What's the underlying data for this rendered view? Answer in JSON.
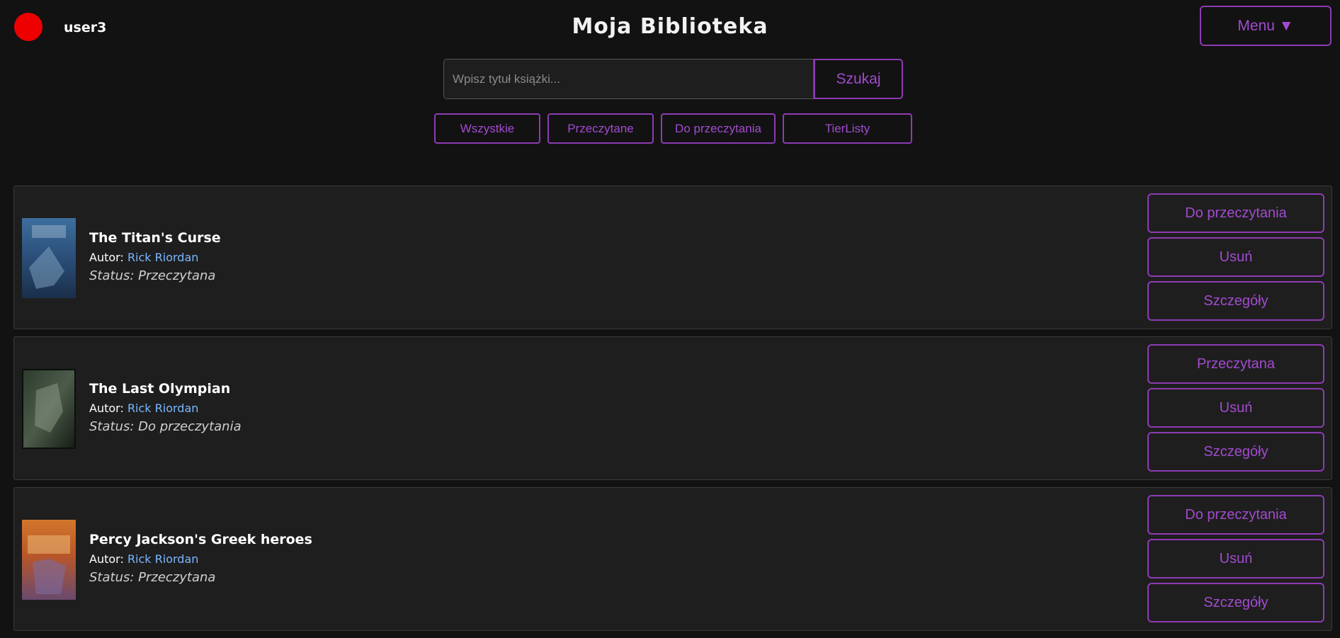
{
  "user": {
    "name": "user3"
  },
  "header": {
    "title": "Moja Biblioteka",
    "menu_label": "Menu ▼"
  },
  "search": {
    "placeholder": "Wpisz tytuł książki...",
    "value": "",
    "button_label": "Szukaj"
  },
  "filters": [
    "Wszystkie",
    "Przeczytane",
    "Do przeczytania",
    "TierListy"
  ],
  "author_prefix": "Autor:",
  "books": [
    {
      "title": "The Titan's Curse",
      "author": "Rick Riordan",
      "status": "Status: Przeczytana",
      "actions": [
        "Do przeczytania",
        "Usuń",
        "Szczegóły"
      ]
    },
    {
      "title": "The Last Olympian",
      "author": "Rick Riordan",
      "status": "Status: Do przeczytania",
      "actions": [
        "Przeczytana",
        "Usuń",
        "Szczegóły"
      ]
    },
    {
      "title": "Percy Jackson's Greek heroes",
      "author": "Rick Riordan",
      "status": "Status: Przeczytana",
      "actions": [
        "Do przeczytania",
        "Usuń",
        "Szczegóły"
      ]
    }
  ],
  "colors": {
    "accent": "#8e3bb3",
    "accent_text": "#a24bd0",
    "link": "#7ab8ff",
    "avatar": "#ee0000"
  }
}
